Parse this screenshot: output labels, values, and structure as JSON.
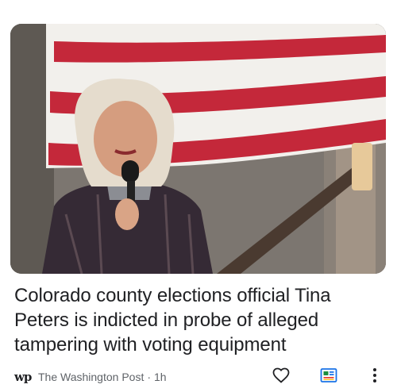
{
  "article": {
    "image_alt": "Tina Peters speaking into a microphone in front of an American flag",
    "headline": "Colorado county elections official Tina Peters is indicted in probe of alleged tampering with voting equipment",
    "publisher": {
      "logo_text": "wp",
      "name": "The Washington Post",
      "separator": "·",
      "time": "1h"
    }
  },
  "actions": {
    "like_icon": "heart-outline-icon",
    "coverage_icon": "full-coverage-icon",
    "more_icon": "more-vert-icon"
  },
  "colors": {
    "text": "#202124",
    "secondary_text": "#5f6368",
    "coverage_blue": "#1a73e8",
    "coverage_green": "#1e8e3e",
    "flag_red": "#c4283a"
  }
}
